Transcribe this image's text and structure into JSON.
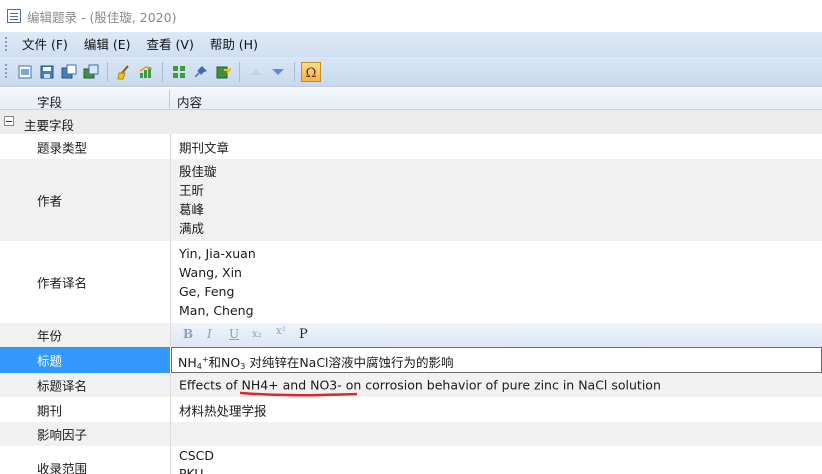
{
  "window": {
    "title": "编辑题录 - (殷佳璇, 2020)"
  },
  "menu": [
    "文件 (F)",
    "编辑 (E)",
    "查看 (V)",
    "帮助 (H)"
  ],
  "toolbar": {
    "icons": [
      "new-record-icon",
      "save-icon",
      "save-as-icon",
      "attach-icon",
      "broom-icon",
      "chart-icon",
      "grid-icon",
      "pin-icon",
      "export-icon",
      "up-icon",
      "down-icon",
      "omega-icon"
    ]
  },
  "columns": {
    "field": "字段",
    "content": "内容"
  },
  "group": {
    "label": "主要字段"
  },
  "fields": {
    "type": {
      "label": "题录类型",
      "value": "期刊文章"
    },
    "authors": {
      "label": "作者",
      "values": [
        "殷佳璇",
        "王昕",
        "葛峰",
        "满成"
      ]
    },
    "authors_translated": {
      "label": "作者译名",
      "values": [
        "Yin, Jia-xuan",
        "Wang, Xin",
        "Ge, Feng",
        "Man, Cheng"
      ]
    },
    "year": {
      "label": "年份"
    },
    "title": {
      "label": "标题",
      "value_part1": "NH",
      "sub1": "4",
      "sup1": "+",
      "value_part2": "和NO",
      "sub2": "3",
      "value_part3": " 对纯锌在NaCl溶液中腐蚀行为的影响"
    },
    "title_translated": {
      "label": "标题译名",
      "value": "Effects of NH4+ and NO3- on corrosion behavior of pure zinc in NaCl solution"
    },
    "journal": {
      "label": "期刊",
      "value": "材料热处理学报"
    },
    "impact": {
      "label": "影响因子",
      "value": ""
    },
    "indexed": {
      "label": "收录范围",
      "values": [
        "CSCD",
        "PKU"
      ]
    }
  },
  "format_bar": {
    "bold": "B",
    "italic": "I",
    "underline": "U",
    "subscript": "x₂",
    "superscript": "x²",
    "special": "P"
  },
  "colors": {
    "selection": "#3399ff",
    "annotation": "#e0262b",
    "toolbar": "#d9e6f5"
  }
}
